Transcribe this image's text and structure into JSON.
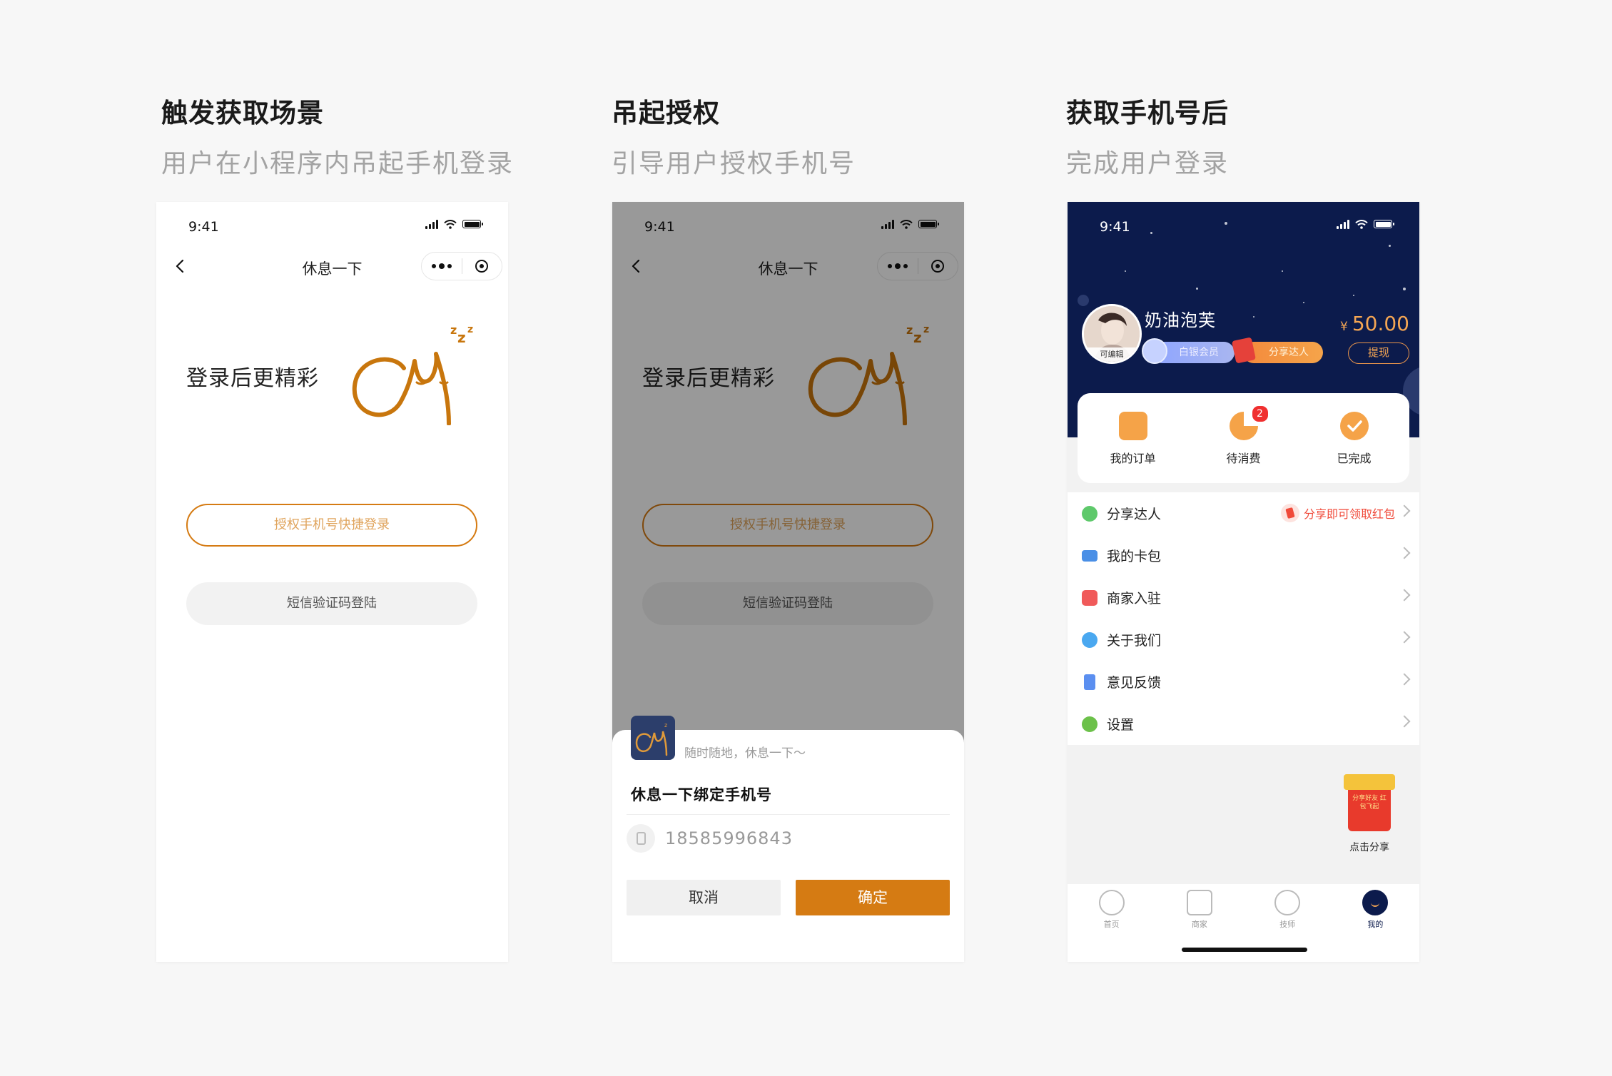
{
  "columns": [
    {
      "title": "触发获取场景",
      "subtitle": "用户在小程序内吊起手机登录"
    },
    {
      "title": "吊起授权",
      "subtitle": "引导用户授权手机号"
    },
    {
      "title": "获取手机号后",
      "subtitle": "完成用户登录"
    }
  ],
  "status_time": "9:41",
  "screen1": {
    "nav_title": "休息一下",
    "hero_text": "登录后更精彩",
    "btn_phone_login": "授权手机号快捷登录",
    "btn_sms_login": "短信验证码登陆"
  },
  "screen2": {
    "nav_title": "休息一下",
    "hero_text": "登录后更精彩",
    "btn_phone_login": "授权手机号快捷登录",
    "btn_sms_login": "短信验证码登陆",
    "sheet": {
      "app_desc": "随时随地，休息一下～",
      "bind_title": "休息一下绑定手机号",
      "phone_number": "18585996843",
      "cancel_label": "取消",
      "confirm_label": "确定"
    }
  },
  "screen3": {
    "avatar_tag": "可编辑",
    "username": "奶油泡芙",
    "badge_member": "白银会员",
    "badge_share": "分享达人",
    "balance_currency": "¥",
    "balance_value": "50.00",
    "withdraw_label": "提现",
    "orders": [
      {
        "label": "我的订单",
        "icon": "order-icon",
        "color": "#f5a348"
      },
      {
        "label": "待消费",
        "icon": "pending-icon",
        "color": "#f5a348",
        "badge": "2"
      },
      {
        "label": "已完成",
        "icon": "done-icon",
        "color": "#f5a348"
      }
    ],
    "menu": [
      {
        "label": "分享达人",
        "icon": "share-icon",
        "color": "#5ec96b",
        "promo": "分享即可领取红包"
      },
      {
        "label": "我的卡包",
        "icon": "card-icon",
        "color": "#4a8fe6"
      },
      {
        "label": "商家入驻",
        "icon": "store-icon",
        "color": "#f05a5a"
      },
      {
        "label": "关于我们",
        "icon": "info-icon",
        "color": "#4aa8f0"
      },
      {
        "label": "意见反馈",
        "icon": "feedback-icon",
        "color": "#5b8ff0"
      },
      {
        "label": "设置",
        "icon": "settings-icon",
        "color": "#6cc14a"
      }
    ],
    "share_float": {
      "label": "点击分享",
      "gift_text": "分享好友 红包飞起"
    },
    "tabs": [
      {
        "label": "首页",
        "icon": "home-moon-icon"
      },
      {
        "label": "商家",
        "icon": "shop-icon"
      },
      {
        "label": "技师",
        "icon": "technician-icon"
      },
      {
        "label": "我的",
        "icon": "profile-icon",
        "active": true
      }
    ]
  }
}
